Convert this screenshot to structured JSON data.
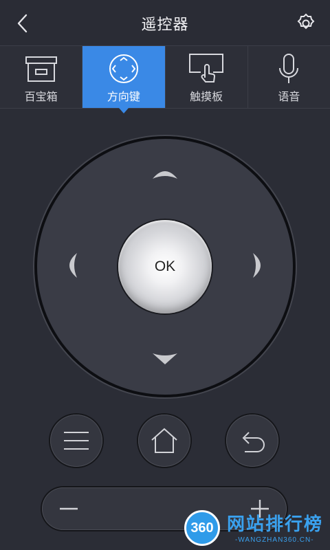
{
  "header": {
    "title": "遥控器",
    "back_icon": "chevron-left-icon",
    "settings_icon": "gear-icon"
  },
  "tabs": [
    {
      "label": "百宝箱",
      "icon": "box-icon",
      "active": false
    },
    {
      "label": "方向键",
      "icon": "direction-pad-icon",
      "active": true
    },
    {
      "label": "触摸板",
      "icon": "touchpad-icon",
      "active": false
    },
    {
      "label": "语音",
      "icon": "microphone-icon",
      "active": false
    }
  ],
  "dpad": {
    "ok_label": "OK",
    "up_icon": "arrow-up-icon",
    "down_icon": "arrow-down-icon",
    "left_icon": "arrow-left-icon",
    "right_icon": "arrow-right-icon"
  },
  "buttons": {
    "menu_icon": "menu-icon",
    "home_icon": "home-icon",
    "back_icon": "undo-back-icon"
  },
  "volume": {
    "minus_icon": "minus-icon",
    "plus_icon": "plus-icon"
  },
  "watermark": {
    "badge": "360",
    "title": "网站排行榜",
    "subtitle": "-WANGZHAN360.CN-"
  },
  "colors": {
    "background": "#2b2d36",
    "active_tab": "#3a89e6",
    "watermark": "#3aa1ee"
  }
}
